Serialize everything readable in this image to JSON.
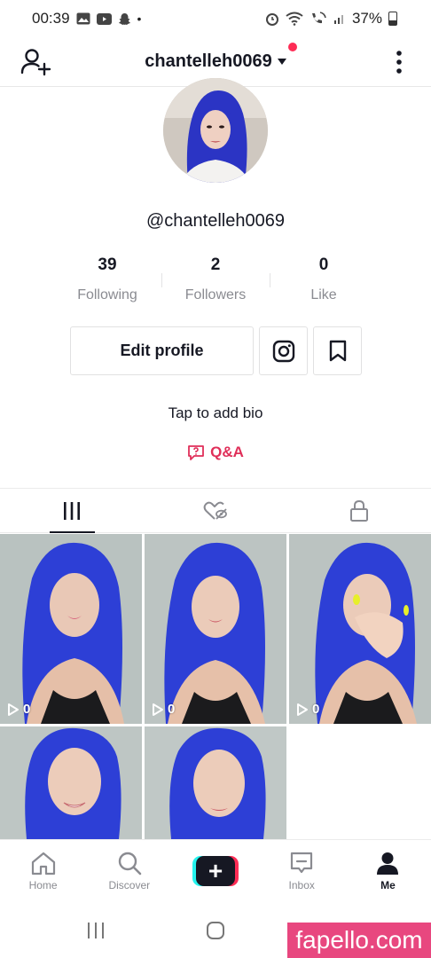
{
  "status_bar": {
    "time": "00:39",
    "battery": "37%"
  },
  "header": {
    "username": "chantelleh0069"
  },
  "profile": {
    "handle": "@chantelleh0069",
    "stats": [
      {
        "value": "39",
        "label": "Following"
      },
      {
        "value": "2",
        "label": "Followers"
      },
      {
        "value": "0",
        "label": "Like"
      }
    ],
    "edit_label": "Edit profile",
    "bio_prompt": "Tap to add bio",
    "qa_label": "Q&A"
  },
  "tabs": [
    "videos-grid",
    "liked",
    "private"
  ],
  "videos": [
    {
      "views": "0"
    },
    {
      "views": "0"
    },
    {
      "views": "0"
    },
    {
      "views": ""
    },
    {
      "views": ""
    }
  ],
  "bottom_nav": [
    {
      "label": "Home",
      "icon": "home-icon"
    },
    {
      "label": "Discover",
      "icon": "search-icon"
    },
    {
      "label": "+",
      "icon": "create-icon"
    },
    {
      "label": "Inbox",
      "icon": "inbox-icon"
    },
    {
      "label": "Me",
      "icon": "profile-icon",
      "active": true
    }
  ],
  "watermark": "fapello.com",
  "colors": {
    "accent": "#fe2c55",
    "qa": "#e02f59",
    "hair": "#2d3fd6"
  }
}
